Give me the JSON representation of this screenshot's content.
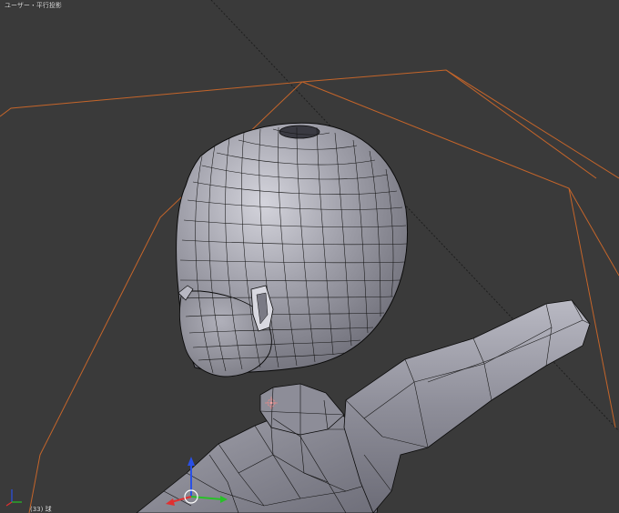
{
  "viewport": {
    "view_label": "ユーザー・平行投影",
    "object_label": "(33) 球",
    "colors": {
      "background": "#3a3a3a",
      "mesh_light": "#c9c9d1",
      "mesh_mid": "#9696a0",
      "mesh_dark": "#6f6f7a",
      "wire": "#0a0a0a",
      "camera_frame": "#c5652a",
      "axis_x": "#e03030",
      "axis_y": "#28c028",
      "axis_z": "#2a50e6"
    },
    "icons": [
      "3d-cursor-icon",
      "transform-manipulator-icon",
      "mini-axes-icon",
      "pivot-marker-icon"
    ]
  }
}
